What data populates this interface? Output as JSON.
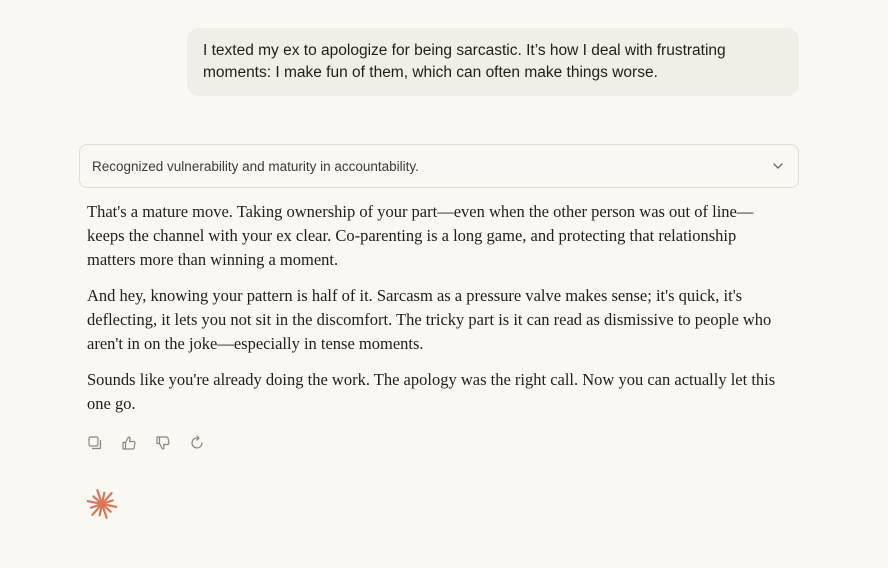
{
  "user_message": {
    "text": "I texted my ex to apologize for being sarcastic. It’s how I deal with frustrating moments: I make fun of them, which can often make things worse."
  },
  "thinking": {
    "summary": "Recognized vulnerability and maturity in accountability.",
    "chevron_icon": "chevron-down-icon"
  },
  "response": {
    "paragraphs": [
      "That's a mature move. Taking ownership of your part—even when the other person was out of line—keeps the channel with your ex clear. Co-parenting is a long game, and protecting that relationship matters more than winning a moment.",
      "And hey, knowing your pattern is half of it. Sarcasm as a pressure valve makes sense; it's quick, it's deflecting, it lets you not sit in the discomfort. The tricky part is it can read as dismissive to people who aren't in on the joke—especially in tense moments.",
      "Sounds like you're already doing the work. The apology was the right call. Now you can actually let this one go."
    ]
  },
  "actions": {
    "icons": [
      "copy-icon",
      "thumbs-up-icon",
      "thumbs-down-icon",
      "retry-icon"
    ]
  },
  "colors": {
    "background": "#f9f8f3",
    "user_bubble": "#f0eee6",
    "accent_spark": "#d97757",
    "icon_gray": "#8a8679"
  }
}
